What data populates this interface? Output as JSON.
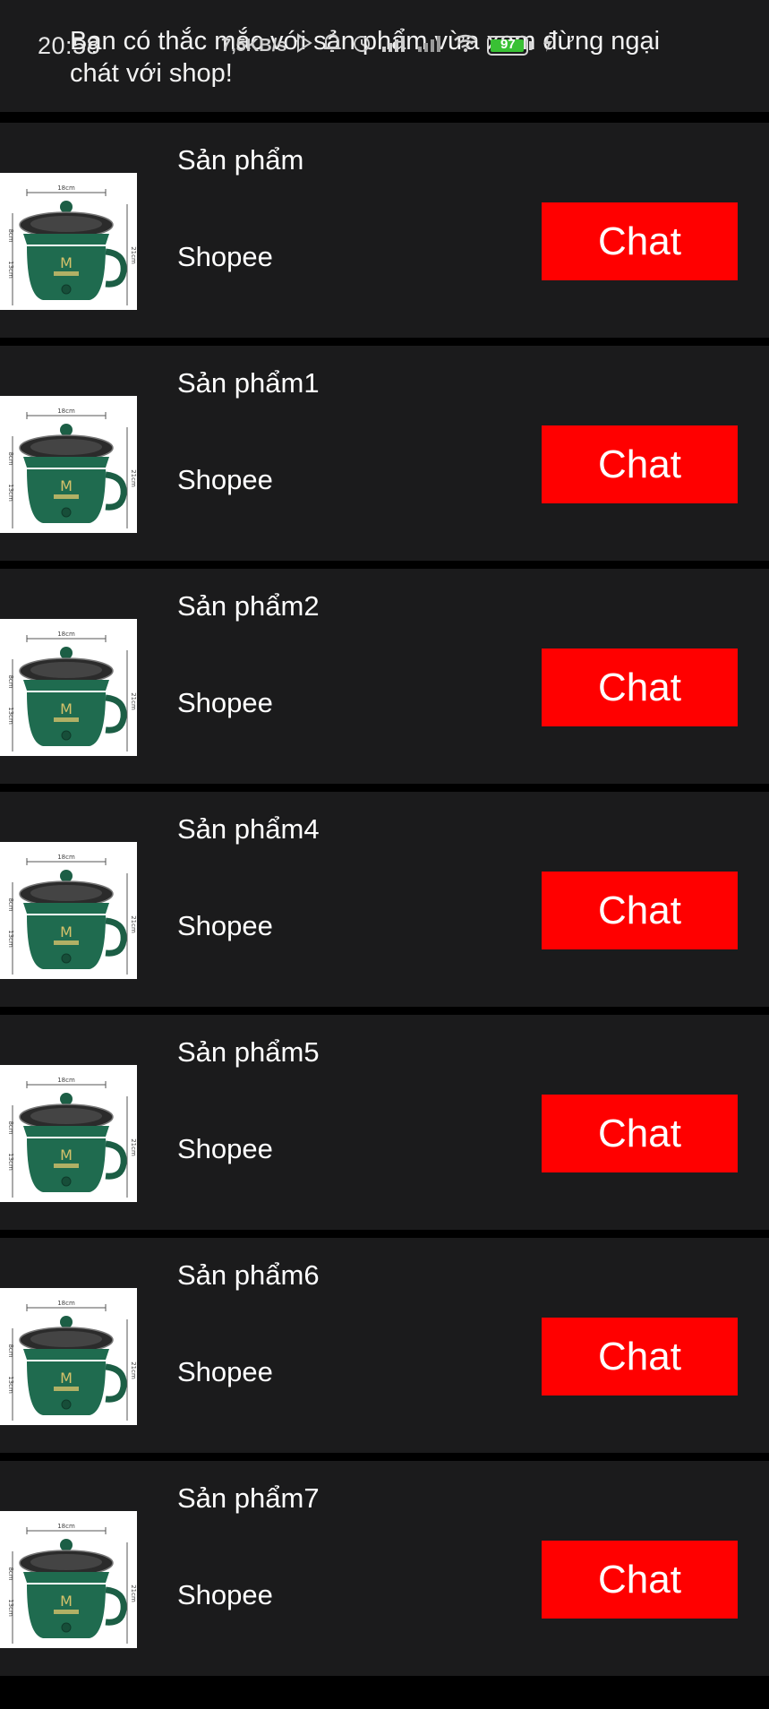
{
  "status_bar": {
    "time": "20:58",
    "speed": "7,5KB/s",
    "battery": "97",
    "battery_level": 0.97
  },
  "header": {
    "message": "Bạn có thắc mắc với sản phẩm vừa xem đừng ngại chát với shop!"
  },
  "products": [
    {
      "name": "Sản phẩm",
      "shop": "Shopee",
      "chat_label": "Chat"
    },
    {
      "name": "Sản phẩm1",
      "shop": "Shopee",
      "chat_label": "Chat"
    },
    {
      "name": "Sản phẩm2",
      "shop": "Shopee",
      "chat_label": "Chat"
    },
    {
      "name": "Sản phẩm4",
      "shop": "Shopee",
      "chat_label": "Chat"
    },
    {
      "name": "Sản phẩm5",
      "shop": "Shopee",
      "chat_label": "Chat"
    },
    {
      "name": "Sản phẩm6",
      "shop": "Shopee",
      "chat_label": "Chat"
    },
    {
      "name": "Sản phẩm7",
      "shop": "Shopee",
      "chat_label": "Chat"
    }
  ],
  "product_image": {
    "icon": "rice-cooker-icon",
    "dim_top": "18cm",
    "dim_side": "21cm",
    "dim_left_top": "8cm",
    "dim_left_bottom": "13cm"
  },
  "colors": {
    "background": "#000000",
    "card": "#1b1b1c",
    "chat_button": "#ff0000",
    "pot": "#1f6b4f"
  }
}
